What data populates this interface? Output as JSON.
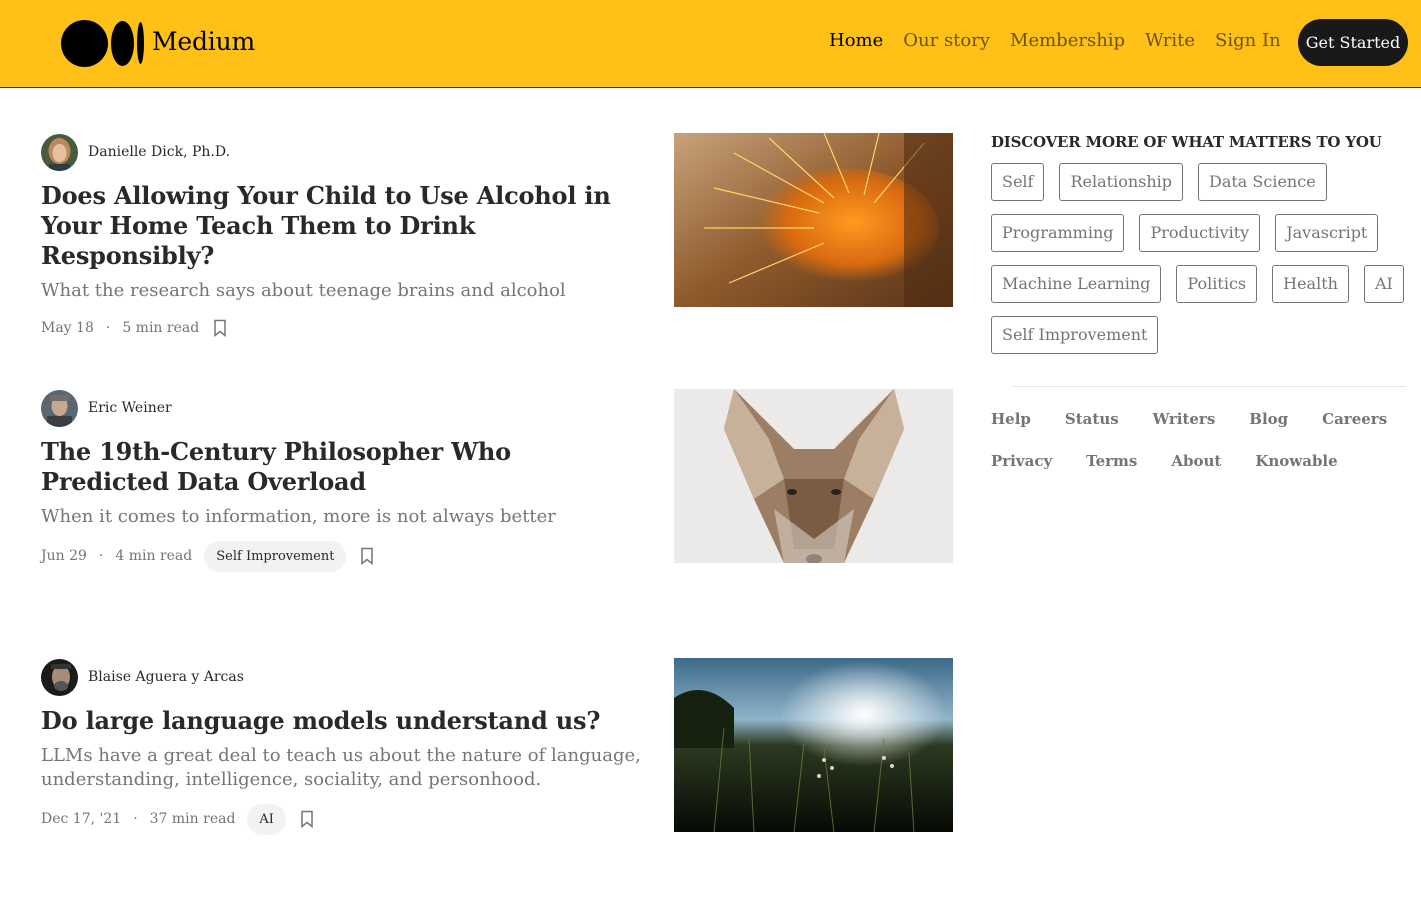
{
  "header": {
    "brand": "Medium",
    "nav": [
      "Home",
      "Our story",
      "Membership",
      "Write",
      "Sign In"
    ],
    "cta": "Get Started",
    "colors": {
      "bar": "#ffc017",
      "cta": "#191919"
    }
  },
  "articles": [
    {
      "author": "Danielle Dick, Ph.D.",
      "title": "Does Allowing Your Child to Use Alcohol in Your Home Teach Them to Drink Responsibly?",
      "subtitle": "What the research says about teenage brains and alcohol",
      "date": "May 18",
      "read_time": "5 min read",
      "tag": "",
      "thumb": "cactus-photo"
    },
    {
      "author": "Eric Weiner",
      "title": "The 19th-Century Philosopher Who Predicted Data Overload",
      "subtitle": "When it comes to information, more is not always better",
      "date": "Jun 29",
      "read_time": "4 min read",
      "tag": "Self Improvement",
      "thumb": "coyote-photo"
    },
    {
      "author": "Blaise Aguera y Arcas",
      "title": "Do large language models understand us?",
      "subtitle": "LLMs have a great deal to teach us about the nature of language, understanding, intelligence, sociality, and personhood.",
      "date": "Dec 17, '21",
      "read_time": "37 min read",
      "tag": "AI",
      "thumb": "meadow-photo"
    }
  ],
  "sidebar": {
    "heading": "DISCOVER MORE OF WHAT MATTERS TO YOU",
    "topics": [
      "Self",
      "Relationship",
      "Data Science",
      "Programming",
      "Productivity",
      "Javascript",
      "Machine Learning",
      "Politics",
      "Health",
      "AI",
      "Self Improvement"
    ],
    "footer": [
      "Help",
      "Status",
      "Writers",
      "Blog",
      "Careers",
      "Privacy",
      "Terms",
      "About",
      "Knowable"
    ]
  }
}
